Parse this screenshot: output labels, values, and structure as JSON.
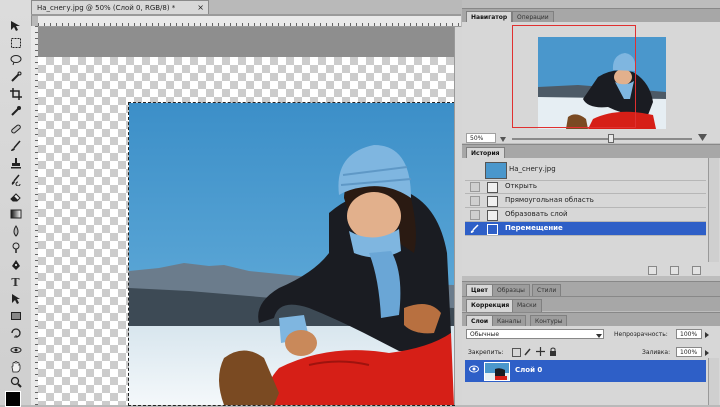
{
  "document": {
    "tab_title": "На_снегу.jpg @ 50% (Слой 0, RGB/8) *",
    "close_glyph": "×"
  },
  "toolbox": {
    "tools": [
      "move-tool",
      "marquee-tool",
      "lasso-tool",
      "quick-select-tool",
      "crop-tool",
      "eyedropper-tool",
      "healing-tool",
      "brush-tool",
      "clone-stamp-tool",
      "history-brush-tool",
      "eraser-tool",
      "gradient-tool",
      "blur-tool",
      "dodge-tool",
      "pen-tool",
      "type-tool",
      "path-select-tool",
      "shape-tool",
      "3d-rotate-tool",
      "3d-orbit-tool",
      "hand-tool",
      "zoom-tool"
    ],
    "foreground_color": "#000000"
  },
  "navigator": {
    "tabs": [
      "Навигатор",
      "Операции"
    ],
    "active_tab": 0,
    "zoom": "50%",
    "zoom_slider_fraction": 0.55,
    "proxy_color": "#e03030"
  },
  "history": {
    "tabs": [
      "История"
    ],
    "snapshot_label": "На_снегу.jpg",
    "items": [
      "Открыть",
      "Прямоугольная область",
      "Образовать слой",
      "Перемещение"
    ],
    "selected_index": 3,
    "selection_color": "#2e5fc7"
  },
  "adjust_tabs": [
    "Цвет",
    "Образцы",
    "Стили"
  ],
  "mid_tabs": [
    "Коррекция",
    "Маски"
  ],
  "layers": {
    "tabs": [
      "Слои",
      "Каналы",
      "Контуры"
    ],
    "blend_mode": "Обычные",
    "opacity_label": "Непрозрачность:",
    "opacity_value": "100%",
    "lock_label": "Закрепить:",
    "fill_label": "Заливка:",
    "fill_value": "100%",
    "layer_name": "Слой 0"
  }
}
